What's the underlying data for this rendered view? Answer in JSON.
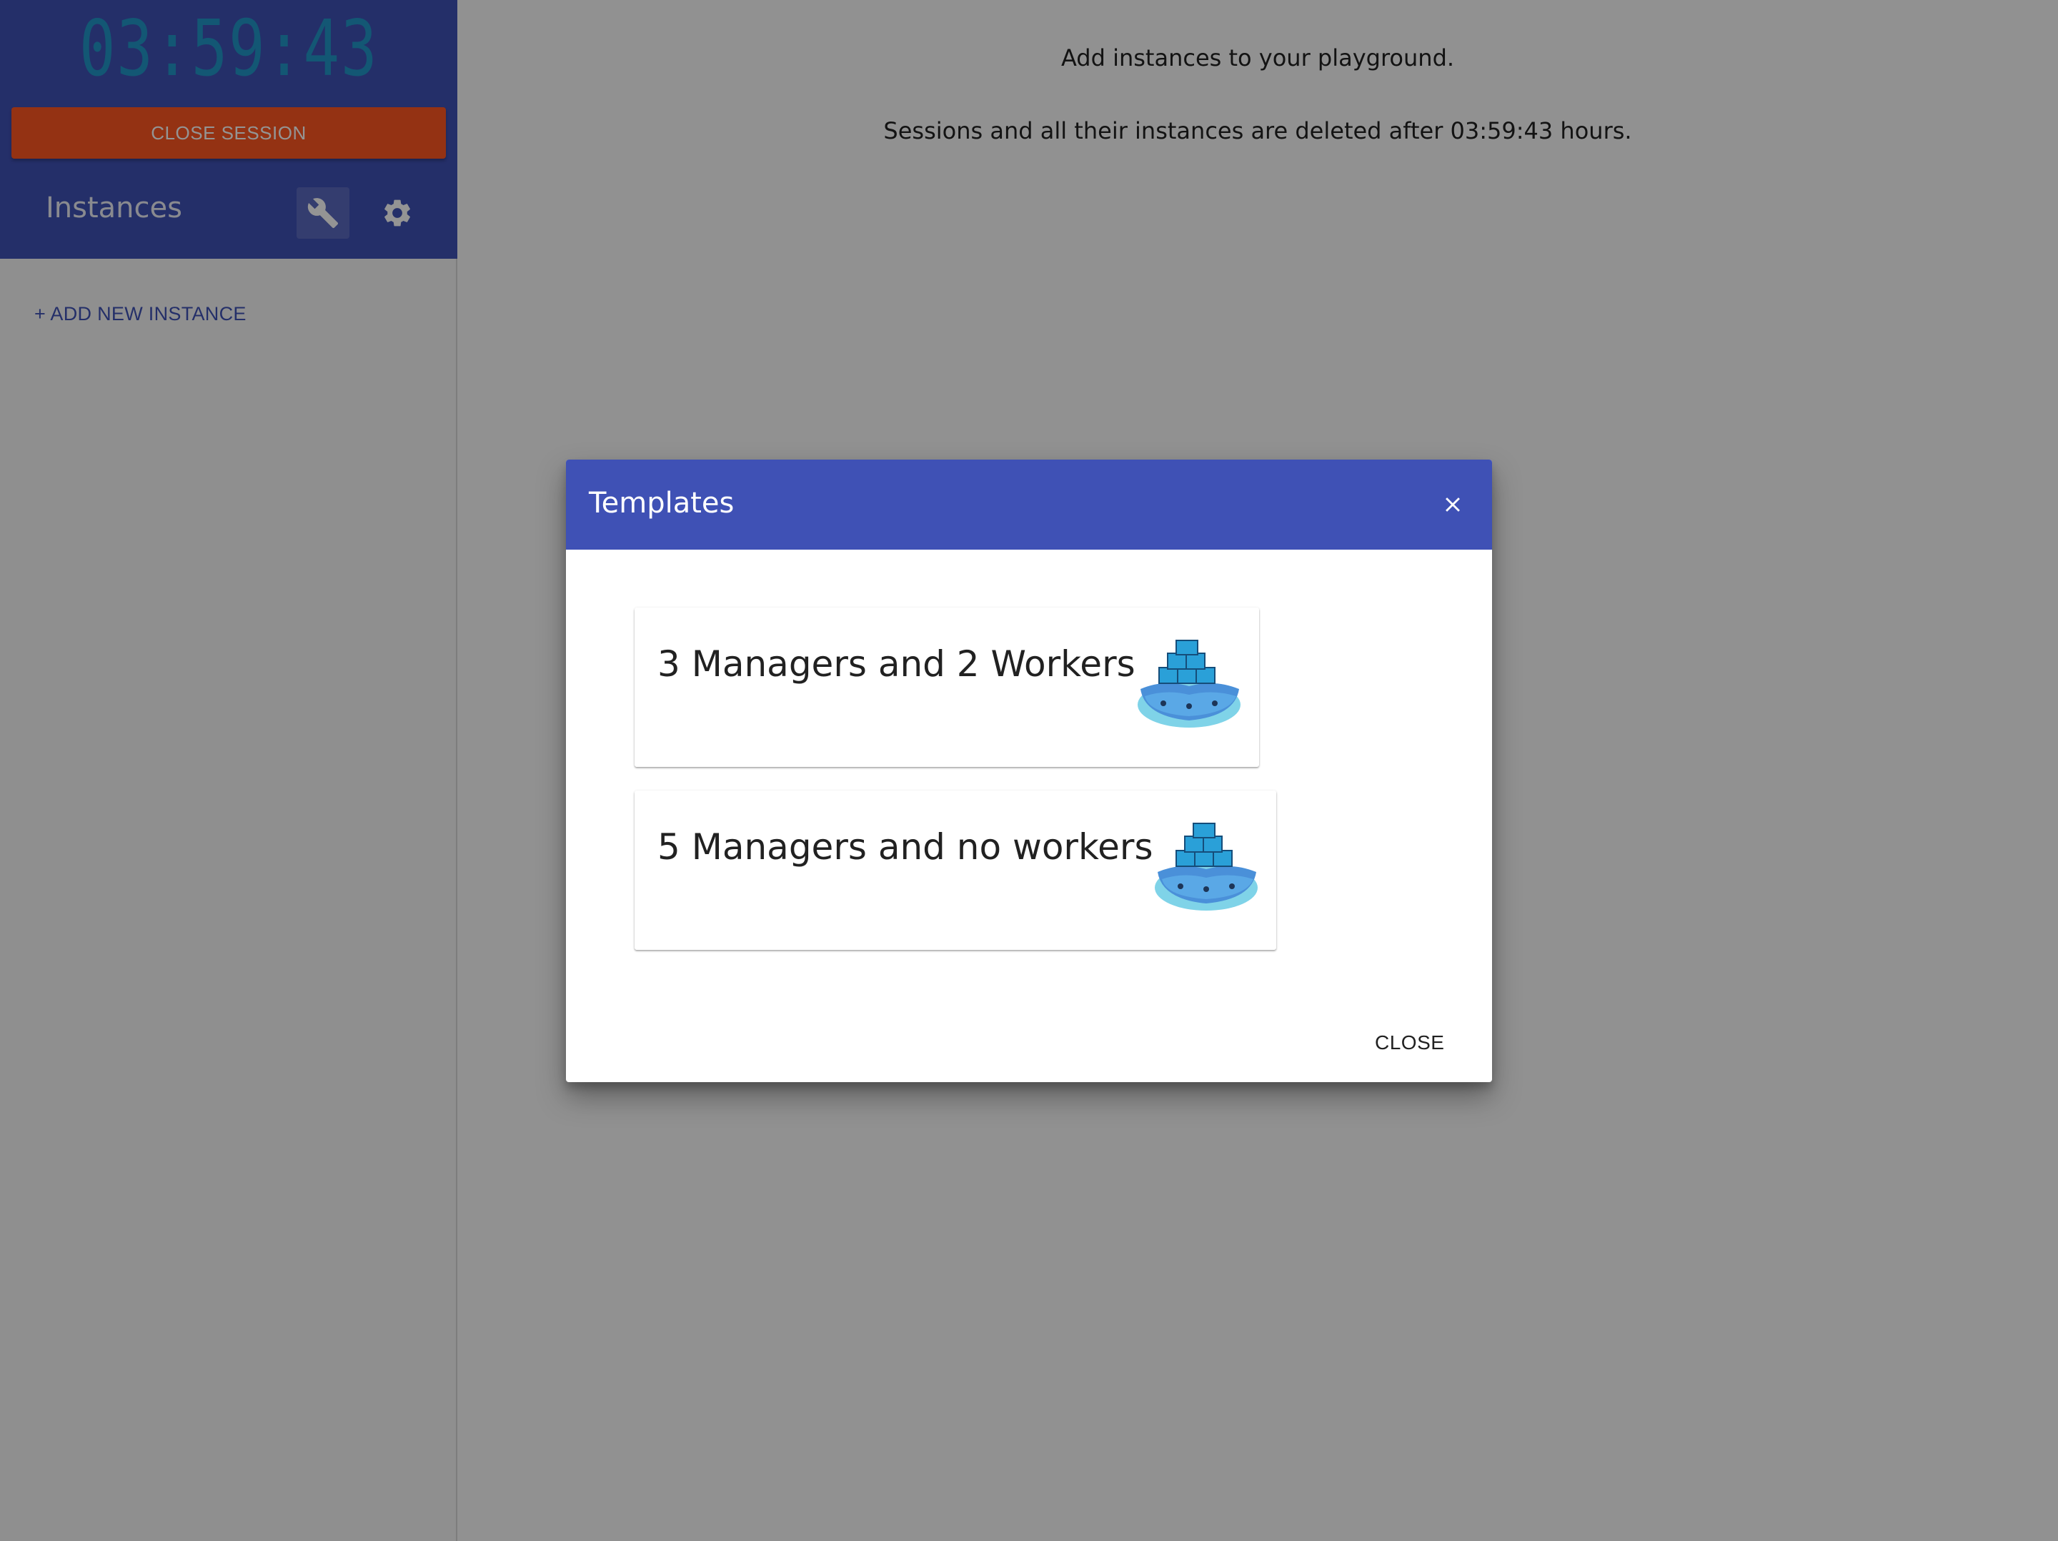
{
  "sidebar": {
    "timer": "03:59:43",
    "close_session_label": "CLOSE SESSION",
    "instances_title": "Instances",
    "tool_icon": "wrench-icon",
    "settings_icon": "gear-icon",
    "add_instance_label": "+ ADD NEW INSTANCE"
  },
  "main": {
    "message_1": "Add instances to your playground.",
    "message_2": "Sessions and all their instances are deleted after 03:59:43 hours."
  },
  "dialog": {
    "title": "Templates",
    "close_icon": "close-icon",
    "templates": [
      {
        "label": "3 Managers and 2 Workers",
        "icon": "docker-swarm-icon"
      },
      {
        "label": "5 Managers and no workers",
        "icon": "docker-swarm-icon"
      }
    ],
    "close_label": "CLOSE"
  },
  "colors": {
    "primary": "#3f51b5",
    "close_session": "#ff5722",
    "timer": "#2196c9",
    "backdrop": "rgba(0,0,0,0.42)"
  }
}
